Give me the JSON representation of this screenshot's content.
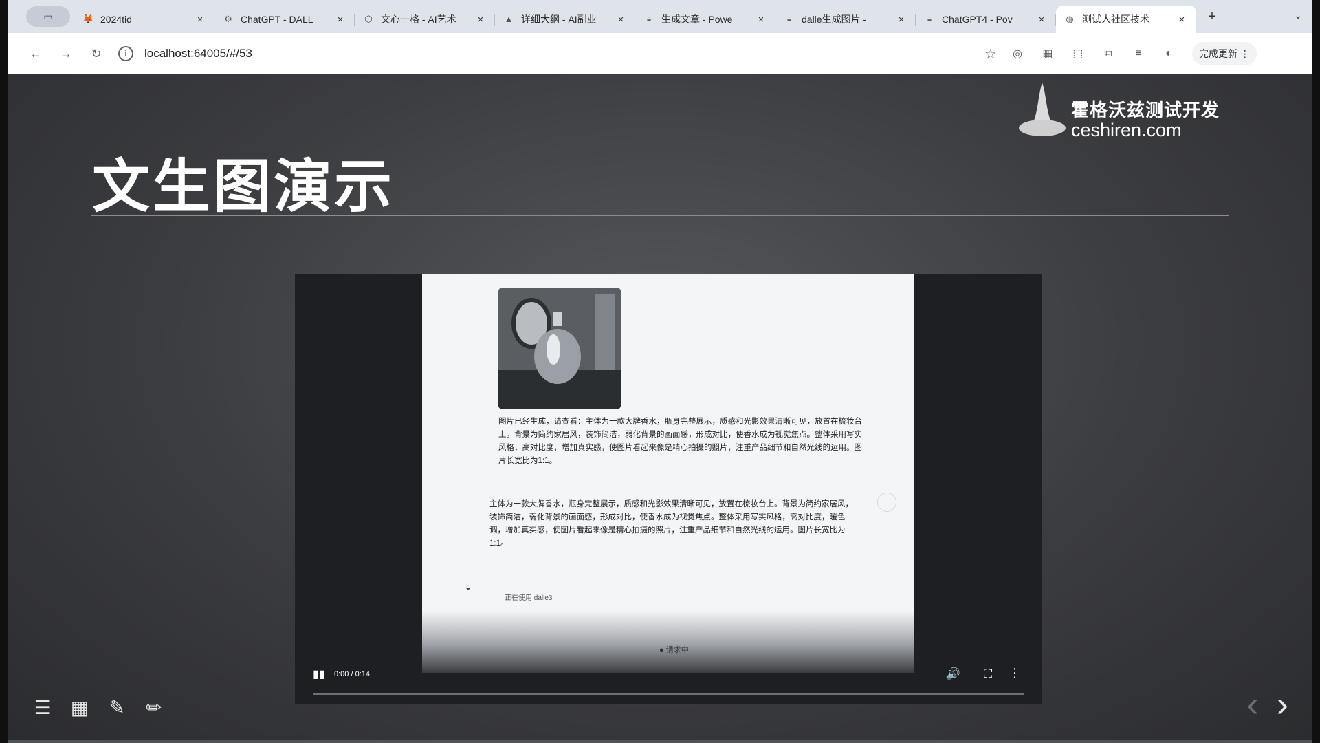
{
  "browser": {
    "tabs": [
      {
        "title": "2024tid",
        "favicon": "fox-icon",
        "active": false
      },
      {
        "title": "ChatGPT - DALL",
        "favicon": "openai-icon",
        "active": false
      },
      {
        "title": "文心一格 - AI艺术",
        "favicon": "cube-icon",
        "active": false
      },
      {
        "title": "详细大纲 - AI副业",
        "favicon": "wizard-hat-icon",
        "active": false
      },
      {
        "title": "生成文章 - Powe",
        "favicon": "bot-icon",
        "active": false
      },
      {
        "title": "dalle生成图片 - ",
        "favicon": "bot-icon",
        "active": false
      },
      {
        "title": "ChatGPT4 - Pov",
        "favicon": "bot-icon",
        "active": false
      },
      {
        "title": "测试人社区技术",
        "favicon": "globe-icon",
        "active": true
      }
    ],
    "new_tab_symbol": "+",
    "url": "localhost:64005/#/53",
    "profile_label": "完成更新"
  },
  "slide": {
    "title": "文生图演示",
    "logo_cn": "霍格沃兹测试开发",
    "logo_en": "ceshiren.com"
  },
  "video": {
    "time_display": "0:00 / 0:14",
    "progress_fraction": 0.0,
    "frame": {
      "message1": "图片已经生成，请查看：主体为一款大牌香水，瓶身完整展示，质感和光影效果清晰可见，放置在梳妆台上。背景为简约家居风，装饰简洁，弱化背景的画面感，形成对比，使香水成为视觉焦点。整体采用写实风格，高对比度，增加真实感，使图片看起来像是精心拍摄的照片，注重产品细节和自然光线的运用。图片长宽比为1:1。",
      "message2": "主体为一款大牌香水，瓶身完整展示，质感和光影效果清晰可见，放置在梳妆台上。背景为简约家居风，装饰简洁，弱化背景的画面感，形成对比，使香水成为视觉焦点。整体采用写实风格，高对比度，暖色调，增加真实感，使图片看起来像是精心拍摄的照片，注重产品细节和自然光线的运用。图片长宽比为1:1。",
      "model_status": "正在使用 dalle3",
      "loading_text": "● 请求中"
    }
  },
  "deck": {
    "progress_fraction": 1.0
  }
}
